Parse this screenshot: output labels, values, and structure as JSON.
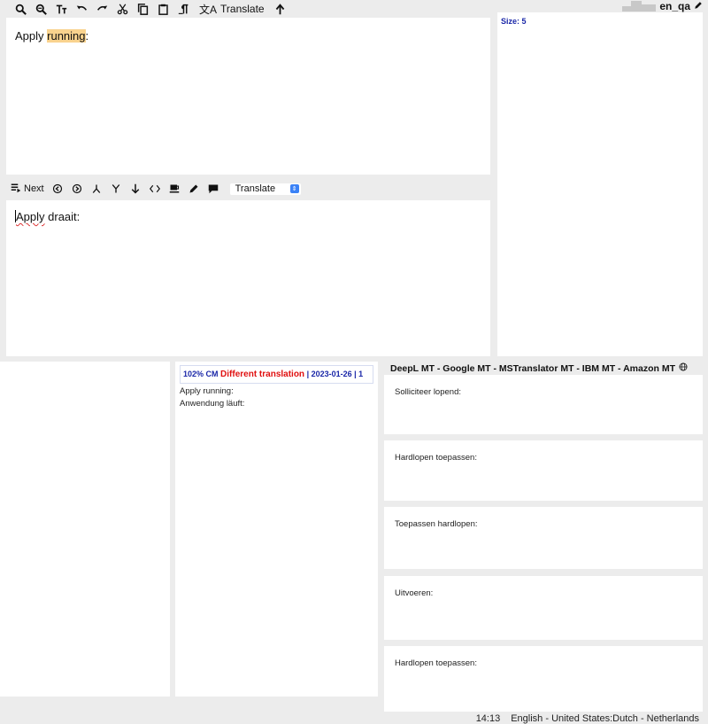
{
  "toolbar": {
    "translate_label": "Translate",
    "icons": [
      "zoom-in-icon",
      "zoom-out-icon",
      "font-size-icon",
      "undo-icon",
      "redo-icon",
      "cut-icon",
      "copy-icon",
      "paste-icon",
      "paragraph-icon",
      "translate-icon",
      "upload-icon"
    ]
  },
  "user": {
    "name": "en_qa"
  },
  "source": {
    "before": "Apply ",
    "highlight": "running",
    "after": ":"
  },
  "target_toolbar": {
    "next_label": "Next",
    "select_value": "Translate"
  },
  "target": {
    "misspelled": "Apply",
    "rest": " draait:"
  },
  "side_panel": {
    "size_label": "Size: 5"
  },
  "tm_match": {
    "score": "102% CM",
    "status": "Different translation",
    "date": "| 2023-01-26 | 1",
    "source": "Apply running:",
    "target": "Anwendung läuft:"
  },
  "mt": {
    "title": "DeepL MT - Google MT - MSTranslator MT - IBM MT - Amazon MT",
    "suggestions": [
      "Solliciteer lopend:",
      "Hardlopen toepassen:",
      "Toepassen hardlopen:",
      "Uitvoeren:",
      "Hardlopen toepassen:"
    ]
  },
  "status_bar": {
    "time": "14:13",
    "languages": "English - United States:Dutch - Netherlands"
  }
}
